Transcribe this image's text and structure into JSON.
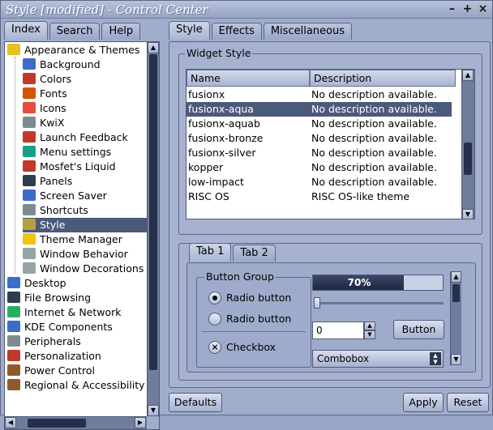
{
  "window": {
    "title": "Style [modified] - Control Center"
  },
  "titlebar_buttons": {
    "minimize": "–",
    "maximize": "+",
    "close": "×"
  },
  "left_tabs": [
    {
      "label": "Index",
      "active": true
    },
    {
      "label": "Search",
      "active": false
    },
    {
      "label": "Help",
      "active": false
    }
  ],
  "tree": [
    {
      "label": "Appearance & Themes",
      "level": 0,
      "icon": "star-icon",
      "color": "#e8c020"
    },
    {
      "label": "Background",
      "level": 1,
      "icon": "background-icon",
      "color": "#3a6cc8"
    },
    {
      "label": "Colors",
      "level": 1,
      "icon": "colors-icon",
      "color": "#c0392b"
    },
    {
      "label": "Fonts",
      "level": 1,
      "icon": "fonts-icon",
      "color": "#d35400"
    },
    {
      "label": "Icons",
      "level": 1,
      "icon": "icons-icon",
      "color": "#e74c3c"
    },
    {
      "label": "KwiX",
      "level": 1,
      "icon": "kwix-icon",
      "color": "#7f8c8d"
    },
    {
      "label": "Launch Feedback",
      "level": 1,
      "icon": "rocket-icon",
      "color": "#c0392b"
    },
    {
      "label": "Menu settings",
      "level": 1,
      "icon": "menu-icon",
      "color": "#16a085"
    },
    {
      "label": "Mosfet's Liquid",
      "level": 1,
      "icon": "liquid-icon",
      "color": "#c0392b"
    },
    {
      "label": "Panels",
      "level": 1,
      "icon": "panels-icon",
      "color": "#2c3e50"
    },
    {
      "label": "Screen Saver",
      "level": 1,
      "icon": "screensaver-icon",
      "color": "#3a6cc8"
    },
    {
      "label": "Shortcuts",
      "level": 1,
      "icon": "shortcuts-icon",
      "color": "#7f8c8d"
    },
    {
      "label": "Style",
      "level": 1,
      "icon": "style-icon",
      "color": "#b8a040",
      "selected": true
    },
    {
      "label": "Theme Manager",
      "level": 1,
      "icon": "theme-icon",
      "color": "#f1c40f"
    },
    {
      "label": "Window Behavior",
      "level": 1,
      "icon": "window-behavior-icon",
      "color": "#95a5a6"
    },
    {
      "label": "Window Decorations",
      "level": 1,
      "icon": "window-decorations-icon",
      "color": "#95a5a6"
    },
    {
      "label": "Desktop",
      "level": 0,
      "icon": "desktop-icon",
      "color": "#3a6cc8"
    },
    {
      "label": "File Browsing",
      "level": 0,
      "icon": "file-browsing-icon",
      "color": "#2c3e50"
    },
    {
      "label": "Internet & Network",
      "level": 0,
      "icon": "globe-icon",
      "color": "#27ae60"
    },
    {
      "label": "KDE Components",
      "level": 0,
      "icon": "kde-icon",
      "color": "#3a6cc8"
    },
    {
      "label": "Peripherals",
      "level": 0,
      "icon": "peripherals-icon",
      "color": "#7f8c8d"
    },
    {
      "label": "Personalization",
      "level": 0,
      "icon": "person-icon",
      "color": "#c0392b"
    },
    {
      "label": "Power Control",
      "level": 0,
      "icon": "power-icon",
      "color": "#8e5a2a"
    },
    {
      "label": "Regional & Accessibility",
      "level": 0,
      "icon": "regional-icon",
      "color": "#8e5a2a"
    }
  ],
  "right_tabs": [
    {
      "label": "Style",
      "active": true
    },
    {
      "label": "Effects",
      "active": false
    },
    {
      "label": "Miscellaneous",
      "active": false
    }
  ],
  "widget_style": {
    "group_label": "Widget Style",
    "columns": [
      "Name",
      "Description"
    ],
    "rows": [
      {
        "name": "fusionx",
        "desc": "No description available."
      },
      {
        "name": "fusionx-aqua",
        "desc": "No description available.",
        "selected": true
      },
      {
        "name": "fusionx-aquab",
        "desc": "No description available."
      },
      {
        "name": "fusionx-bronze",
        "desc": "No description available."
      },
      {
        "name": "fusionx-silver",
        "desc": "No description available."
      },
      {
        "name": "kopper",
        "desc": "No description available."
      },
      {
        "name": "low-impact",
        "desc": "No description available."
      },
      {
        "name": "RISC OS",
        "desc": "RISC OS-like theme"
      }
    ]
  },
  "preview": {
    "tabs": [
      {
        "label": "Tab 1",
        "active": true
      },
      {
        "label": "Tab 2",
        "active": false
      }
    ],
    "button_group_label": "Button Group",
    "radio1": "Radio button",
    "radio2": "Radio button",
    "checkbox": "Checkbox",
    "progress_text": "70%",
    "progress_value": 0.7,
    "spin_value": "0",
    "button_label": "Button",
    "combo_value": "Combobox"
  },
  "bottom_buttons": {
    "defaults": "Defaults",
    "apply": "Apply",
    "reset": "Reset"
  }
}
